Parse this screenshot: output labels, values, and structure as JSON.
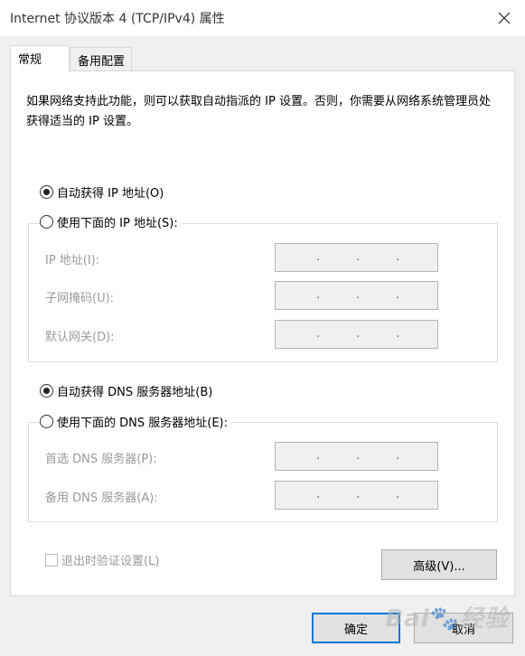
{
  "window": {
    "title": "Internet 协议版本 4 (TCP/IPv4) 属性"
  },
  "tabs": [
    {
      "label": "常规",
      "active": true
    },
    {
      "label": "备用配置",
      "active": false
    }
  ],
  "description": "如果网络支持此功能，则可以获取自动指派的 IP 设置。否则，你需要从网络系统管理员处获得适当的 IP 设置。",
  "ip": {
    "auto_label": "自动获得 IP 地址(O)",
    "manual_label": "使用下面的 IP 地址(S):",
    "auto_selected": true,
    "fields": [
      {
        "label": "IP 地址(I):",
        "value": ""
      },
      {
        "label": "子网掩码(U):",
        "value": ""
      },
      {
        "label": "默认网关(D):",
        "value": ""
      }
    ]
  },
  "dns": {
    "auto_label": "自动获得 DNS 服务器地址(B)",
    "manual_label": "使用下面的 DNS 服务器地址(E):",
    "auto_selected": true,
    "fields": [
      {
        "label": "首选 DNS 服务器(P):",
        "value": ""
      },
      {
        "label": "备用 DNS 服务器(A):",
        "value": ""
      }
    ]
  },
  "validate_label": "退出时验证设置(L)",
  "advanced_label": "高级(V)...",
  "ok_label": "确定",
  "cancel_label": "取消",
  "watermark": "Baidu 经验"
}
